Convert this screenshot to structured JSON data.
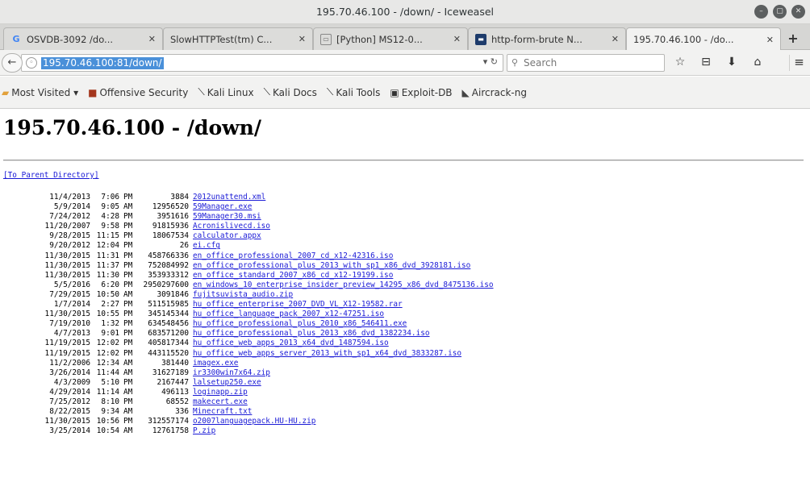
{
  "window": {
    "title": "195.70.46.100 - /down/ - Iceweasel"
  },
  "tabs": [
    {
      "label": "OSVDB-3092 /do...",
      "icon": "google-icon",
      "active": false
    },
    {
      "label": "SlowHTTPTest(tm) C...",
      "icon": "",
      "active": false
    },
    {
      "label": "[Python] MS12-0...",
      "icon": "page-icon",
      "active": false
    },
    {
      "label": "http-form-brute N...",
      "icon": "nmap-icon",
      "active": false
    },
    {
      "label": "195.70.46.100 - /do...",
      "icon": "",
      "active": true
    }
  ],
  "nav": {
    "url": "195.70.46.100:81/down/",
    "search_placeholder": "Search"
  },
  "bookmarks": [
    {
      "label": "Most Visited ▾",
      "icon": "folder-icon"
    },
    {
      "label": "Offensive Security",
      "icon": "offsec-icon"
    },
    {
      "label": "Kali Linux",
      "icon": "kali-icon"
    },
    {
      "label": "Kali Docs",
      "icon": "kali-icon"
    },
    {
      "label": "Kali Tools",
      "icon": "kali-icon"
    },
    {
      "label": "Exploit-DB",
      "icon": "exploitdb-icon"
    },
    {
      "label": "Aircrack-ng",
      "icon": "aircrack-icon"
    }
  ],
  "page": {
    "heading": "195.70.46.100 - /down/",
    "parent_link": "[To Parent Directory]"
  },
  "files": [
    {
      "date": "11/4/2013",
      "time": "7:06",
      "ampm": "PM",
      "size": "3884",
      "name": "2012unattend.xml"
    },
    {
      "date": "5/9/2014",
      "time": "9:05",
      "ampm": "AM",
      "size": "12956520",
      "name": "59Manager.exe"
    },
    {
      "date": "7/24/2012",
      "time": "4:28",
      "ampm": "PM",
      "size": "3951616",
      "name": "59Manager30.msi"
    },
    {
      "date": "11/20/2007",
      "time": "9:58",
      "ampm": "PM",
      "size": "91815936",
      "name": "Acronislivecd.iso"
    },
    {
      "date": "9/28/2015",
      "time": "11:15",
      "ampm": "PM",
      "size": "18067534",
      "name": "calculator.appx"
    },
    {
      "date": "9/20/2012",
      "time": "12:04",
      "ampm": "PM",
      "size": "26",
      "name": "ei.cfg"
    },
    {
      "date": "11/30/2015",
      "time": "11:31",
      "ampm": "PM",
      "size": "458766336",
      "name": "en_office_professional_2007_cd_x12-42316.iso"
    },
    {
      "date": "11/30/2015",
      "time": "11:37",
      "ampm": "PM",
      "size": "752084992",
      "name": "en_office_professional_plus_2013_with_sp1_x86_dvd_3928181.iso"
    },
    {
      "date": "11/30/2015",
      "time": "11:30",
      "ampm": "PM",
      "size": "353933312",
      "name": "en_office_standard_2007_x86_cd_x12-19199.iso"
    },
    {
      "date": "5/5/2016",
      "time": "6:20",
      "ampm": "PM",
      "size": "2950297600",
      "name": "en_windows_10_enterprise_insider_preview_14295_x86_dvd_8475136.iso"
    },
    {
      "date": "7/29/2015",
      "time": "10:50",
      "ampm": "AM",
      "size": "3091846",
      "name": "fujitsuvista_audio.zip"
    },
    {
      "date": "1/7/2014",
      "time": "2:27",
      "ampm": "PM",
      "size": "511515985",
      "name": "hu_office_enterprise_2007_DVD_VL_X12-19582.rar"
    },
    {
      "date": "11/30/2015",
      "time": "10:55",
      "ampm": "PM",
      "size": "345145344",
      "name": "hu_office_language_pack_2007_x12-47251.iso"
    },
    {
      "date": "7/19/2010",
      "time": "1:32",
      "ampm": "PM",
      "size": "634548456",
      "name": "hu_office_professional_plus_2010_x86_546411.exe"
    },
    {
      "date": "4/7/2013",
      "time": "9:01",
      "ampm": "PM",
      "size": "683571200",
      "name": "hu_office_professional_plus_2013_x86_dvd_1382234.iso"
    },
    {
      "date": "11/19/2015",
      "time": "12:02",
      "ampm": "PM",
      "size": "405817344",
      "name": "hu_office_web_apps_2013_x64_dvd_1487594.iso"
    },
    {
      "date": "11/19/2015",
      "time": "12:02",
      "ampm": "PM",
      "size": "443115520",
      "name": "hu_office_web_apps_server_2013_with_sp1_x64_dvd_3833287.iso"
    },
    {
      "date": "11/2/2006",
      "time": "12:34",
      "ampm": "AM",
      "size": "381440",
      "name": "imagex.exe"
    },
    {
      "date": "3/26/2014",
      "time": "11:44",
      "ampm": "AM",
      "size": "31627189",
      "name": "ir3300win7x64.zip"
    },
    {
      "date": "4/3/2009",
      "time": "5:10",
      "ampm": "PM",
      "size": "2167447",
      "name": "lalsetup250.exe"
    },
    {
      "date": "4/29/2014",
      "time": "11:14",
      "ampm": "AM",
      "size": "496113",
      "name": "loginapp.zip"
    },
    {
      "date": "7/25/2012",
      "time": "8:10",
      "ampm": "PM",
      "size": "68552",
      "name": "makecert.exe"
    },
    {
      "date": "8/22/2015",
      "time": "9:34",
      "ampm": "AM",
      "size": "336",
      "name": "Minecraft.txt"
    },
    {
      "date": "11/30/2015",
      "time": "10:56",
      "ampm": "PM",
      "size": "312557174",
      "name": "o2007languagepack.HU-HU.zip"
    },
    {
      "date": "3/25/2014",
      "time": "10:54",
      "ampm": "AM",
      "size": "12761758",
      "name": "P.zip"
    }
  ]
}
